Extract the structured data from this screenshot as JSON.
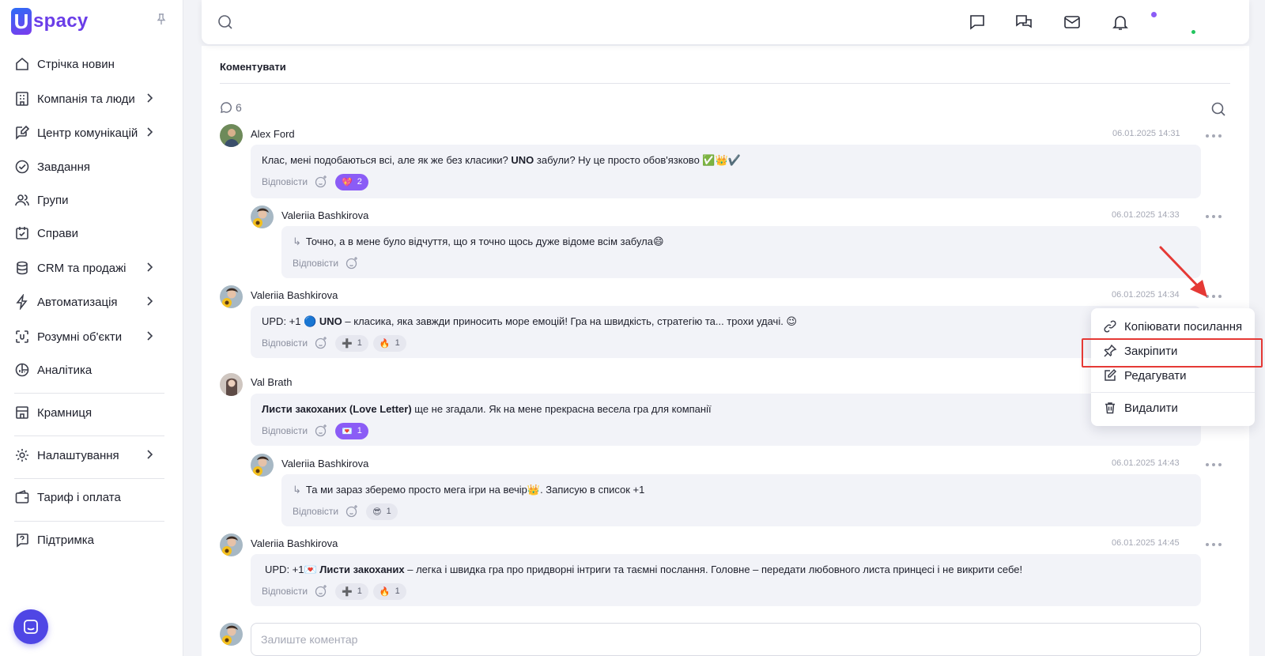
{
  "app": {
    "brand": "spacy",
    "brand_mark": "U",
    "accent": "#6a3de8"
  },
  "sidebar": {
    "items": [
      {
        "label": "Стрічка новин",
        "icon": "home-icon",
        "has_children": false
      },
      {
        "label": "Компанія та люди",
        "icon": "building-icon",
        "has_children": true
      },
      {
        "label": "Центр комунікацій",
        "icon": "chat-edit-icon",
        "has_children": true
      },
      {
        "label": "Завдання",
        "icon": "check-circle-icon",
        "has_children": false
      },
      {
        "label": "Групи",
        "icon": "users-icon",
        "has_children": false
      },
      {
        "label": "Справи",
        "icon": "calendar-check-icon",
        "has_children": false
      },
      {
        "label": "CRM та продажі",
        "icon": "database-icon",
        "has_children": true
      },
      {
        "label": "Автоматизація",
        "icon": "lightning-icon",
        "has_children": true
      },
      {
        "label": "Розумні об'єкти",
        "icon": "smart-object-icon",
        "has_children": true
      },
      {
        "label": "Аналітика",
        "icon": "chart-pie-icon",
        "has_children": false
      },
      {
        "label": "Крамниця",
        "icon": "store-icon",
        "has_children": false
      },
      {
        "label": "Налаштування",
        "icon": "gear-icon",
        "has_children": true
      },
      {
        "label": "Тариф і оплата",
        "icon": "wallet-icon",
        "has_children": false
      },
      {
        "label": "Підтримка",
        "icon": "help-icon",
        "has_children": false
      }
    ]
  },
  "topbar": {
    "icons": [
      "chat-icon",
      "chats-icon",
      "mail-icon",
      "bell-icon"
    ],
    "has_notification": true
  },
  "comments_section": {
    "title": "Коментувати",
    "count": "6",
    "reply_label": "Відповісти",
    "input_placeholder": "Залиште коментар",
    "comments": [
      {
        "author": "Alex Ford",
        "date": "06.01.2025 14:31",
        "text_parts": [
          "Клас, мені подобаються всі, але як же без класики? ",
          "UNO",
          " забули? Ну це просто обов'язково ✅👑✔️"
        ],
        "reactions": [
          {
            "emoji": "💖",
            "count": "2",
            "active": true
          }
        ]
      },
      {
        "author": "Valeriia Bashkirova",
        "date": "06.01.2025 14:33",
        "reply": true,
        "text_parts": [
          "Точно, а в мене було відчуття, що я точно щось дуже відоме всім забула😄",
          "",
          ""
        ],
        "reactions": []
      },
      {
        "author": "Valeriia Bashkirova",
        "date": "06.01.2025 14:34",
        "text_parts": [
          "UPD: +1 🔵 ",
          "UNO",
          "  – класика, яка завжди приносить море емоцій! Гра на швидкість, стратегію та... трохи удачі. 😉"
        ],
        "reactions": [
          {
            "emoji": "➕",
            "count": "1",
            "active": false
          },
          {
            "emoji": "🔥",
            "count": "1",
            "active": false
          }
        ]
      },
      {
        "author": "Val Brath",
        "date": "",
        "text_parts": [
          "",
          "Листи закоханих (Love Letter)",
          " ще не згадали. Як на мене прекрасна весела гра для компанії"
        ],
        "reactions": [
          {
            "emoji": "💌",
            "count": "1",
            "active": true
          }
        ]
      },
      {
        "author": "Valeriia Bashkirova",
        "date": "06.01.2025 14:43",
        "reply": true,
        "text_parts": [
          "Та ми зараз зберемо просто мега ігри на вечір👑. Записую в список +1",
          "",
          ""
        ],
        "reactions": [
          {
            "emoji": "😎",
            "count": "1",
            "active": false
          }
        ]
      },
      {
        "author": "Valeriia Bashkirova",
        "date": "06.01.2025 14:45",
        "text_parts": [
          "UPD: +1💌 ",
          "Листи закоханих",
          " – легка і швидка гра про придворні інтриги та таємні послання. Головне – передати любовного листа принцесі і не викрити себе!"
        ],
        "reactions": [
          {
            "emoji": "➕",
            "count": "1",
            "active": false
          },
          {
            "emoji": "🔥",
            "count": "1",
            "active": false
          }
        ]
      }
    ]
  },
  "context_menu": {
    "items": [
      {
        "label": "Копіювати посилання",
        "icon": "link-icon",
        "highlighted": false
      },
      {
        "label": "Закріпити",
        "icon": "pin-icon",
        "highlighted": true
      },
      {
        "label": "Редагувати",
        "icon": "edit-icon",
        "highlighted": false
      },
      {
        "label": "Видалити",
        "icon": "trash-icon",
        "highlighted": false
      }
    ],
    "highlight_color": "#e53935"
  }
}
